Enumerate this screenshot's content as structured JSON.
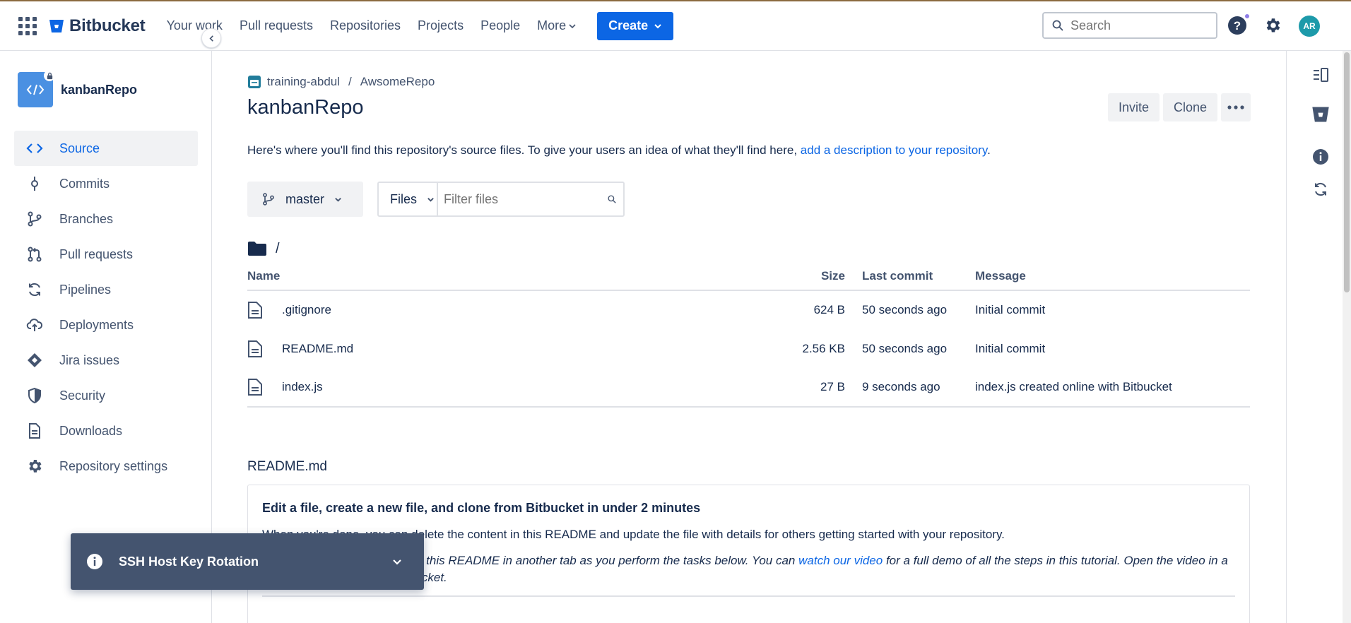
{
  "topnav": {
    "brand": "Bitbucket",
    "items": [
      "Your work",
      "Pull requests",
      "Repositories",
      "Projects",
      "People"
    ],
    "more_label": "More",
    "create_label": "Create",
    "search_placeholder": "Search",
    "avatar_initials": "AR"
  },
  "sidebar": {
    "repo_name": "kanbanRepo",
    "items": [
      {
        "label": "Source",
        "icon": "code-icon",
        "active": true
      },
      {
        "label": "Commits",
        "icon": "commit-icon"
      },
      {
        "label": "Branches",
        "icon": "branch-icon"
      },
      {
        "label": "Pull requests",
        "icon": "pull-request-icon"
      },
      {
        "label": "Pipelines",
        "icon": "pipelines-icon"
      },
      {
        "label": "Deployments",
        "icon": "cloud-upload-icon"
      },
      {
        "label": "Jira issues",
        "icon": "jira-icon"
      },
      {
        "label": "Security",
        "icon": "shield-icon"
      },
      {
        "label": "Downloads",
        "icon": "document-icon"
      },
      {
        "label": "Repository settings",
        "icon": "gear-icon"
      }
    ]
  },
  "breadcrumb": {
    "workspace": "training-abdul",
    "separator": "/",
    "project": "AwsomeRepo"
  },
  "page": {
    "title": "kanbanRepo",
    "invite_label": "Invite",
    "clone_label": "Clone",
    "more_label": "•••",
    "description_prefix": "Here's where you'll find this repository's source files. To give your users an idea of what they'll find here,",
    "description_link": "add a description to your repository",
    "description_suffix": "."
  },
  "toolbar": {
    "branch": "master",
    "files_label": "Files",
    "filter_placeholder": "Filter files"
  },
  "path": "/",
  "table": {
    "headers": {
      "name": "Name",
      "size": "Size",
      "last_commit": "Last commit",
      "message": "Message"
    },
    "rows": [
      {
        "name": ".gitignore",
        "size": "624 B",
        "last_commit": "50 seconds ago",
        "message": "Initial commit"
      },
      {
        "name": "README.md",
        "size": "2.56 KB",
        "last_commit": "50 seconds ago",
        "message": "Initial commit"
      },
      {
        "name": "index.js",
        "size": "27 B",
        "last_commit": "9 seconds ago",
        "message": "index.js created online with Bitbucket"
      }
    ]
  },
  "readme": {
    "title": "README.md",
    "heading": "Edit a file, create a new file, and clone from Bitbucket in under 2 minutes",
    "para1": "When you're done, you can delete the content in this README and update the file with details for others getting started with your repository.",
    "para2_prefix": "We recommend that you open this README in another tab as you perform the tasks below. You can",
    "para2_link": "watch our video",
    "para2_suffix": "for a full demo of all the steps in this tutorial. Open the video in a new tab to avoid leaving Bitbucket."
  },
  "flag": {
    "title": "SSH Host Key Rotation"
  },
  "colors": {
    "primary": "#0c66e4",
    "text": "#172b4d",
    "subtle_text": "#44546f",
    "repo_avatar": "#4a90e2",
    "avatar": "#1d9aaa",
    "flag_bg": "#44546f"
  }
}
